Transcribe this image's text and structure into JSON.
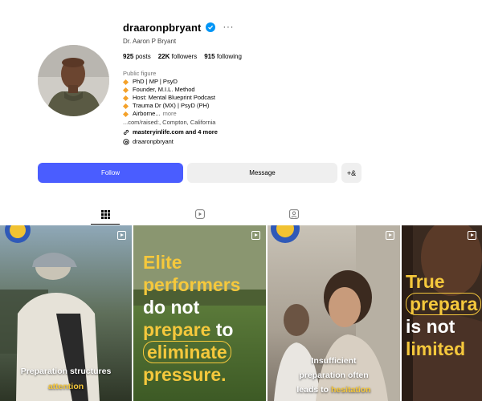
{
  "profile": {
    "username": "draaronpbryant",
    "full_name": "Dr. Aaron P Bryant",
    "stats": {
      "posts": "925",
      "posts_label": "posts",
      "followers": "22K",
      "followers_label": "followers",
      "following": "915",
      "following_label": "following"
    },
    "category": "Public figure",
    "bio": [
      "PhD | MP | PsyD",
      "Founder, M.I.L. Method",
      "Host: Mental Blueprint Podcast",
      "Trauma Dr (MX) | PsyD (PH)",
      "Airborne..."
    ],
    "more_label": "more",
    "location": "...com/raised:, Compton, California",
    "link": "masteryinlife.com and 4 more",
    "threads": "draaronpbryant"
  },
  "actions": {
    "follow": "Follow",
    "message": "Message",
    "add_user": "+&"
  },
  "colors": {
    "follow_bg": "#4a5dff",
    "verified": "#0095f6",
    "accent_yellow": "#f5c83c"
  },
  "tabs": [
    {
      "name": "posts-grid",
      "icon": "grid-icon",
      "active": true
    },
    {
      "name": "reels",
      "icon": "reels-icon",
      "active": false
    },
    {
      "name": "tagged",
      "icon": "tagged-icon",
      "active": false
    }
  ],
  "posts": [
    {
      "caption_line1": "Preparation structures",
      "caption_line2": "attention"
    },
    {
      "l1": "Elite",
      "l2": "performers",
      "l3": "do not",
      "l4a": "prepare",
      "l4b": "to",
      "l5": "eliminate",
      "l6": "pressure."
    },
    {
      "caption_line1": "Insufficient",
      "caption_line2": "preparation often",
      "caption_line3a": "leads to",
      "caption_line3b": "hesitation"
    },
    {
      "l1": "True",
      "l2": "prepara",
      "l3": "is not",
      "l4": "limited"
    }
  ]
}
